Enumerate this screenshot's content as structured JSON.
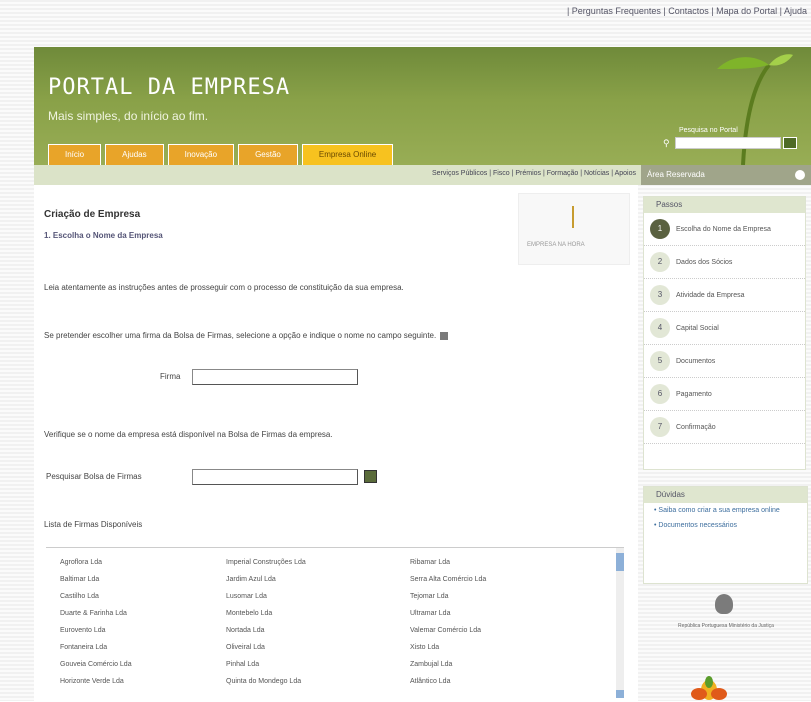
{
  "toplinks": [
    "Perguntas Frequentes",
    "Contactos",
    "Mapa do Portal",
    "Ajuda"
  ],
  "header": {
    "title": "PORTAL DA EMPRESA",
    "subtitle": "Mais simples, do início ao fim.",
    "tabs": [
      "Início",
      "Ajudas",
      "Inovação",
      "Gestão",
      "Empresa Online"
    ],
    "active_tab": 4,
    "search_label": "Pesquisa no Portal"
  },
  "subnav": {
    "links": "Serviços Públicos | Fisco | Prémios | Formação | Notícias | Apoios",
    "access": "Área Reservada"
  },
  "main": {
    "title": "Criação de Empresa",
    "subtitle": "1. Escolha o Nome da Empresa",
    "intro": "Leia atentamente as instruções antes de prosseguir com o processo de constituição da sua empresa.",
    "tip": "Se pretender escolher uma firma da Bolsa de Firmas, selecione a opção e indique o nome no campo seguinte.",
    "field1_label": "Firma",
    "field2_note": "Verifique se o nome da empresa está disponível na Bolsa de Firmas da empresa.",
    "field2_label": "Pesquisar Bolsa de Firmas",
    "list_title": "Lista de Firmas Disponíveis",
    "logo_caption": "EMPRESA NA HORA"
  },
  "firms": {
    "col1": [
      "Agroflora Lda",
      "Baltimar Lda",
      "Castilho Lda",
      "Duarte & Farinha Lda",
      "Eurovento Lda",
      "Fontaneira Lda",
      "Gouveia Comércio Lda",
      "Horizonte Verde Lda"
    ],
    "col2": [
      "Imperial Construções Lda",
      "Jardim Azul Lda",
      "Lusomar Lda",
      "Montebelo Lda",
      "Nortada Lda",
      "Oliveiral Lda",
      "Pinhal Lda",
      "Quinta do Mondego Lda"
    ],
    "col3": [
      "Ribamar Lda",
      "Serra Alta Comércio Lda",
      "Tejomar Lda",
      "Ultramar Lda",
      "Valemar Comércio Lda",
      "Xisto Lda",
      "Zambujal Lda",
      "Atlântico Lda"
    ]
  },
  "sidebar": {
    "steps_title": "Passos",
    "steps": [
      {
        "n": "1",
        "label": "Escolha do Nome da Empresa"
      },
      {
        "n": "2",
        "label": "Dados dos Sócios"
      },
      {
        "n": "3",
        "label": "Atividade da Empresa"
      },
      {
        "n": "4",
        "label": "Capital Social"
      },
      {
        "n": "5",
        "label": "Documentos"
      },
      {
        "n": "6",
        "label": "Pagamento"
      },
      {
        "n": "7",
        "label": "Confirmação"
      }
    ],
    "doubts_title": "Dúvidas",
    "doubts": [
      "Saiba como criar a sua empresa online",
      "Documentos necessários"
    ],
    "seal_text": "República Portuguesa Ministério da Justiça"
  },
  "colors": {
    "header_green": "#89a148",
    "tab_orange": "#e8a429",
    "active_tab": "#f7c21f"
  }
}
